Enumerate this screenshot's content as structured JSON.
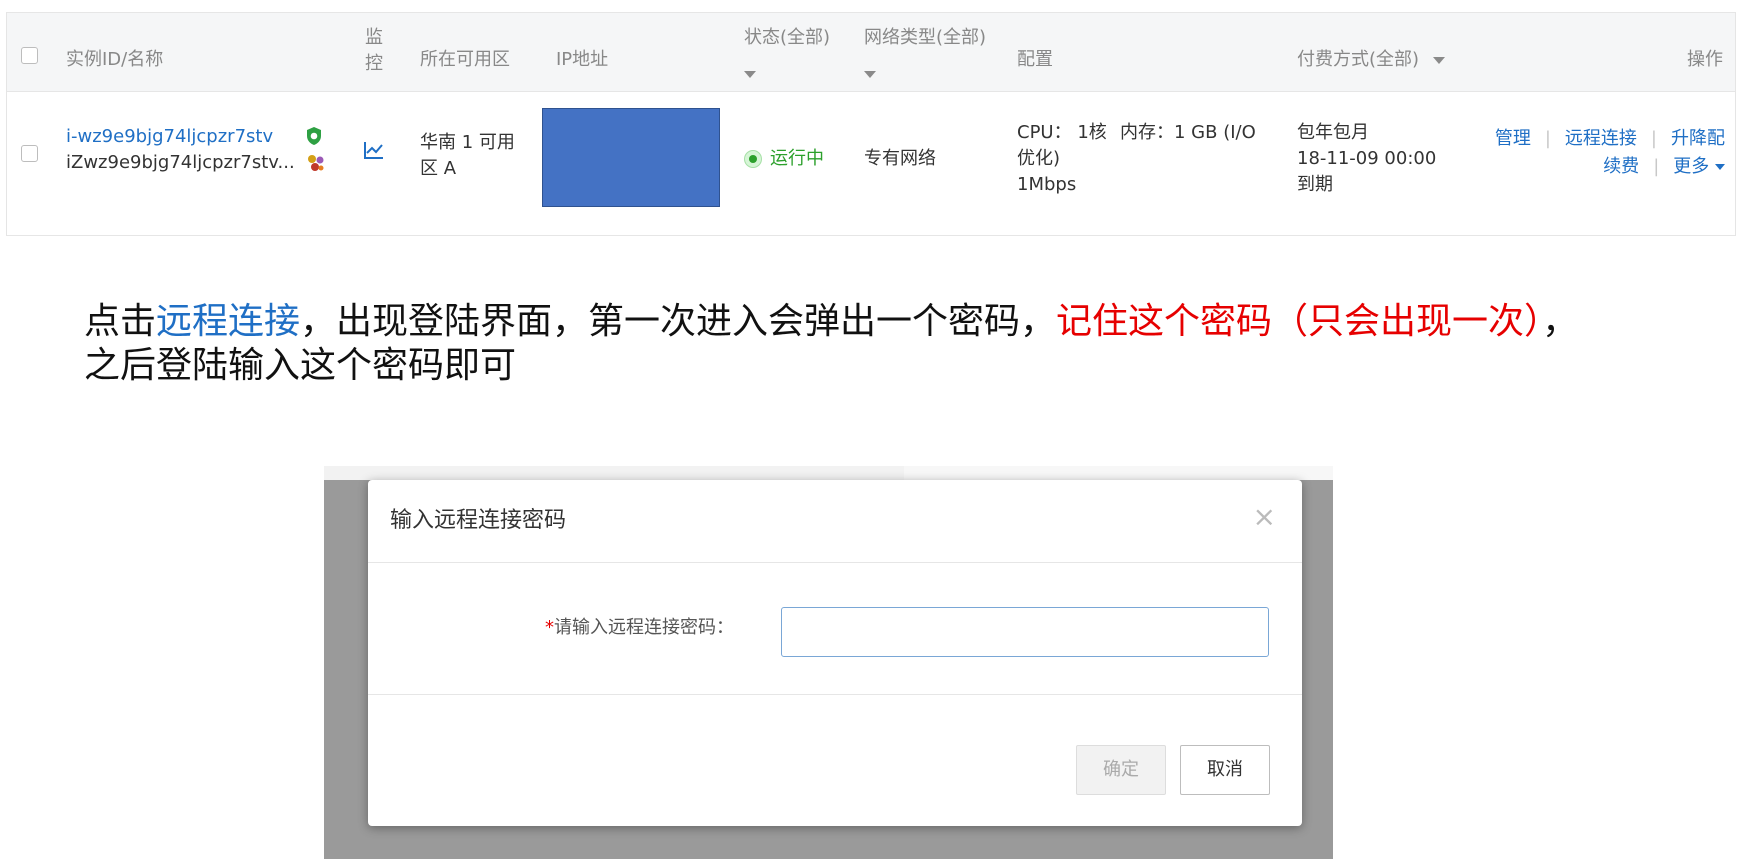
{
  "table": {
    "headers": {
      "instance": "实例ID/名称",
      "monitor_line1": "监",
      "monitor_line2": "控",
      "zone": "所在可用区",
      "ip": "IP地址",
      "status": "状态(全部)",
      "network": "网络类型(全部)",
      "config": "配置",
      "billing": "付费方式(全部)",
      "actions": "操作"
    },
    "row": {
      "instance_id": "i-wz9e9bjg74ljcpzr7stv",
      "instance_name": "iZwz9e9bjg74ljcpzr7stv...",
      "zone_line1": "华南 1 可用",
      "zone_line2": "区 A",
      "status": "运行中",
      "network": "专有网络",
      "config_cpu": "CPU： 1核",
      "config_mem": "内存：1 GB (I/O",
      "config_line2": "优化)",
      "config_line3": "1Mbps",
      "billing_line1": "包年包月",
      "billing_line2": "18-11-09 00:00",
      "billing_line3": "到期",
      "actions": {
        "manage": "管理",
        "remote": "远程连接",
        "upgrade": "升降配",
        "renew": "续费",
        "more": "更多"
      }
    },
    "colors": {
      "link": "#1f6fc5",
      "status_green": "#2ca02c",
      "ip_mask": "#4472c4"
    }
  },
  "instruction": {
    "part1": "点击",
    "part2_blue": "远程连接",
    "part3": "，出现登陆界面，第一次进入会弹出一个密码，",
    "part4_red": "记住这个密码（只会出现一次）",
    "part5": "，",
    "line2": "之后登陆输入这个密码即可"
  },
  "dialog": {
    "title": "输入远程连接密码",
    "close": "×",
    "required_mark": "*",
    "field_label": "请输入远程连接密码：",
    "input_value": "",
    "ok_label": "确定",
    "cancel_label": "取消"
  }
}
